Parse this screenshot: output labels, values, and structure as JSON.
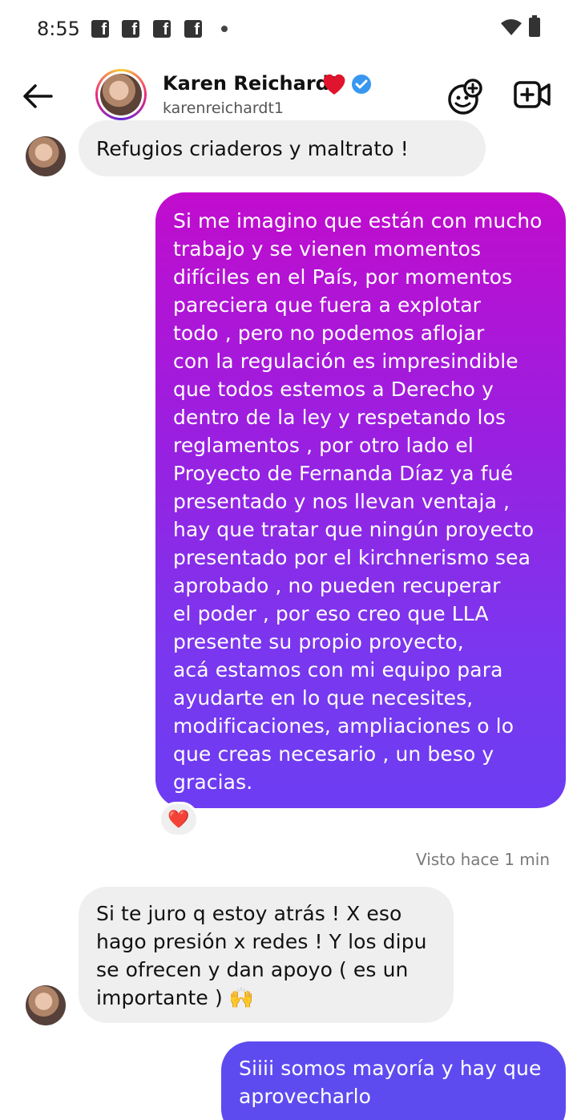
{
  "status_bar": {
    "time": "8:55"
  },
  "header": {
    "name": "Karen Reichardt",
    "handle": "karenreichardt1"
  },
  "messages": [
    {
      "direction": "incoming",
      "text": "Refugios criaderos y maltrato !"
    },
    {
      "direction": "outgoing",
      "text": "Si me imagino que están con mucho\ntrabajo y se vienen momentos\ndifíciles en el País, por momentos\npareciera que fuera a explotar\ntodo , pero no podemos aflojar\ncon la regulación es impresindible\nque todos estemos a Derecho y\ndentro de la ley y respetando los\nreglamentos , por otro lado el\nProyecto de Fernanda Díaz ya fué\npresentado y nos llevan ventaja ,\nhay que tratar que ningún proyecto\npresentado por el kirchnerismo sea\naprobado , no pueden recuperar\nel poder , por eso creo que LLA\npresente su propio proyecto,\nacá estamos con mi equipo para\nayudarte en lo que necesites,\nmodificaciones, ampliaciones o lo\nque creas necesario , un beso y\ngracias."
    },
    {
      "direction": "incoming",
      "text": "Si te juro q estoy atrás ! X eso\nhago presión x redes ! Y los dipu\nse ofrecen y dan apoyo ( es un\nimportante ) 🙌"
    },
    {
      "direction": "outgoing",
      "text": "Siiii somos mayoría y hay que\naprovecharlo"
    }
  ],
  "reaction": "❤️",
  "seen_status": "Visto hace 1 min",
  "colors": {
    "outgoing_gradient_top": "#c10ccd",
    "outgoing_gradient_bottom": "#6c3df2",
    "outgoing_solid": "#5d4bf0",
    "incoming_bg": "#efefef",
    "verified": "#3897f0"
  },
  "icons": [
    "back-arrow-icon",
    "facebook-icon",
    "wifi-icon",
    "battery-icon",
    "heart-emoji-icon",
    "verified-badge-icon",
    "add-emoji-icon",
    "video-call-icon"
  ]
}
